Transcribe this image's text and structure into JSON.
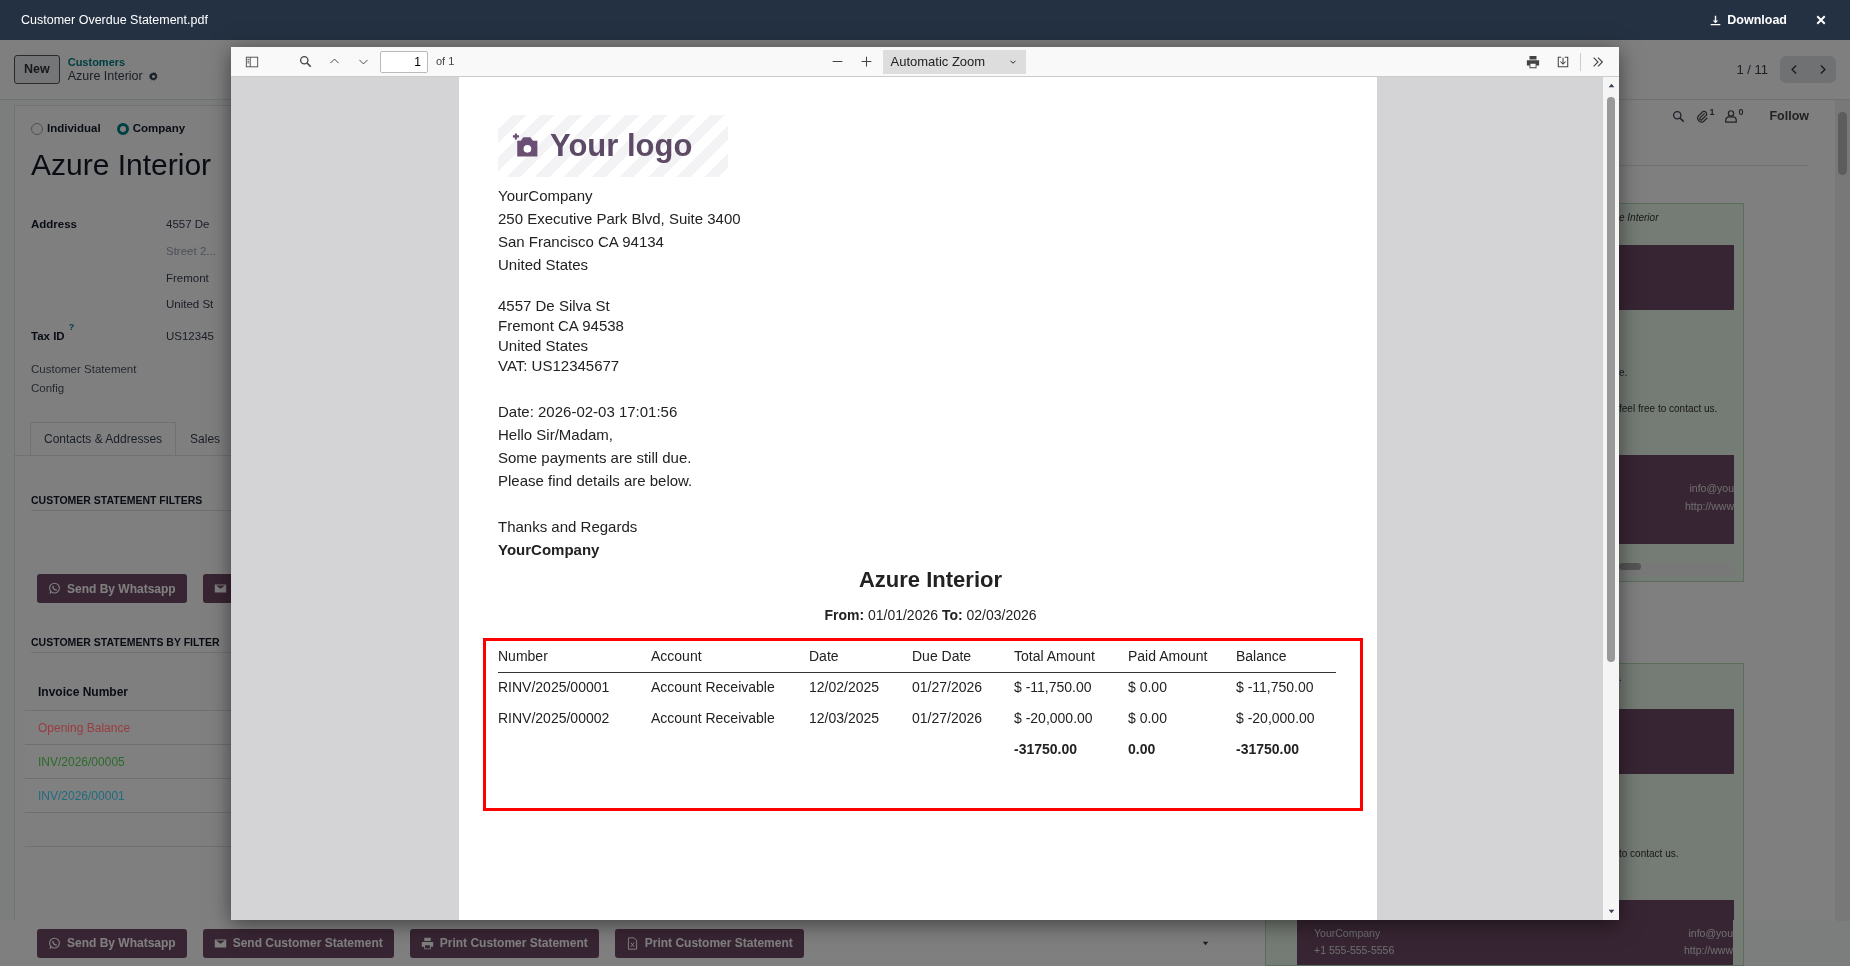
{
  "dialog": {
    "title": "Customer Overdue Statement.pdf",
    "download_label": "Download"
  },
  "control_panel": {
    "new_label": "New",
    "breadcrumb_parent": "Customers",
    "breadcrumb_current": "Azure Interior",
    "pager": "1 / 11"
  },
  "form": {
    "company_types": [
      {
        "label": "Individual",
        "selected": false
      },
      {
        "label": "Company",
        "selected": true
      }
    ],
    "name": "Azure Interior",
    "address_label": "Address",
    "address_lines": [
      {
        "value": "4557 De"
      },
      {
        "placeholder": "Street 2..."
      },
      {
        "value": "Fremont"
      },
      {
        "value": "United St"
      }
    ],
    "tax_label": "Tax ID",
    "tax_help": "?",
    "tax_value": "US12345",
    "config_label": "Customer Statement Config",
    "tabs": [
      {
        "label": "Contacts & Addresses",
        "selected": true
      },
      {
        "label": "Sales",
        "selected": false
      }
    ],
    "filters_heading": "CUSTOMER STATEMENT FILTERS",
    "filter_buttons": [
      {
        "kind": "whatsapp",
        "label": "Send By Whatsapp"
      },
      {
        "kind": "email"
      }
    ],
    "statements_heading": "CUSTOMER STATEMENTS BY FILTER",
    "statements_column": "Invoice Number",
    "statements_rows": [
      {
        "text": "Opening Balance",
        "color": "#9a3b40"
      },
      {
        "text": "INV/2026/00005",
        "color": "#2b6b2b"
      },
      {
        "text": "INV/2026/00001",
        "color": "#1f6b80"
      }
    ],
    "bottom_buttons": [
      {
        "kind": "whatsapp",
        "label": "Send By Whatsapp"
      },
      {
        "kind": "email",
        "label": "Send Customer Statement"
      },
      {
        "kind": "print",
        "label": "Print Customer Statement"
      },
      {
        "kind": "excel",
        "label": "Print Customer Statement"
      }
    ]
  },
  "chatter": {
    "attachment_count": "1",
    "follower_count": "0",
    "follow_label": "Follow",
    "messages": [
      {
        "title": "e Interior",
        "body": [
          "e.",
          "feel free to contact us."
        ],
        "footer_right": [
          "info@you",
          "http://www"
        ]
      },
      {
        "title": ".",
        "body": [
          "to contact us."
        ],
        "footer_left": [
          "YourCompany",
          "+1 555-555-5556"
        ],
        "footer_right": [
          "info@you",
          "http://www"
        ]
      }
    ]
  },
  "viewer": {
    "page": "1",
    "page_count": "of 1",
    "zoom": "Automatic Zoom",
    "document": {
      "logo_text": "Your logo",
      "company_lines": [
        "YourCompany",
        "250 Executive Park Blvd, Suite 3400",
        "San Francisco CA 94134",
        "United States"
      ],
      "partner_lines": [
        "4557 De Silva St",
        "Fremont CA 94538",
        "United States",
        "VAT: US12345677"
      ],
      "message_lines": [
        "Date: 2026-02-03 17:01:56",
        "Hello Sir/Madam,",
        "Some payments are still due.",
        "Please find details are below."
      ],
      "closing": "Thanks and Regards",
      "signature": "YourCompany",
      "title": "Azure Interior",
      "period": "**From:** 01/01/2026 **To:** 02/03/2026",
      "table": {
        "columns": [
          "Number",
          "Account",
          "Date",
          "Due Date",
          "Total Amount",
          "Paid Amount",
          "Balance"
        ],
        "rows": [
          [
            "RINV/2025/00001",
            "Account Receivable",
            "12/02/2025",
            "01/27/2026",
            "$ -11,750.00",
            "$ 0.00",
            "$ -11,750.00"
          ],
          [
            "RINV/2025/00002",
            "Account Receivable",
            "12/03/2025",
            "01/27/2026",
            "$ -20,000.00",
            "$ 0.00",
            "$ -20,000.00"
          ]
        ],
        "totals": [
          "-31750.00",
          "0.00",
          "-31750.00"
        ]
      }
    }
  }
}
